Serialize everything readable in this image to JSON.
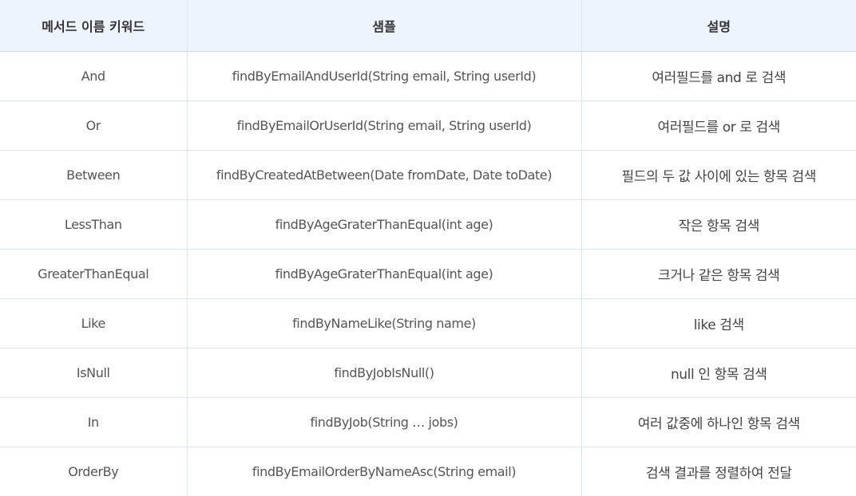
{
  "table": {
    "headers": [
      "메서드 이름 키워드",
      "샘플",
      "설명"
    ],
    "rows": [
      {
        "keyword": "And",
        "sample": "findByEmailAndUserId(String email, String userId)",
        "description": "여러필드를 and 로 검색"
      },
      {
        "keyword": "Or",
        "sample": "findByEmailOrUserId(String email, String userId)",
        "description": "여러필드를 or 로 검색"
      },
      {
        "keyword": "Between",
        "sample": "findByCreatedAtBetween(Date fromDate, Date toDate)",
        "description": "필드의 두 값 사이에 있는 항목 검색"
      },
      {
        "keyword": "LessThan",
        "sample": "findByAgeGraterThanEqual(int age)",
        "description": "작은 항목 검색"
      },
      {
        "keyword": "GreaterThanEqual",
        "sample": "findByAgeGraterThanEqual(int age)",
        "description": "크거나 같은 항목 검색"
      },
      {
        "keyword": "Like",
        "sample": "findByNameLike(String name)",
        "description": "like 검색"
      },
      {
        "keyword": "IsNull",
        "sample": "findByJobIsNull()",
        "description": "null 인 항목 검색"
      },
      {
        "keyword": "In",
        "sample": "findByJob(String … jobs)",
        "description": "여러 값중에 하나인 항목 검색"
      },
      {
        "keyword": "OrderBy",
        "sample": "findByEmailOrderByNameAsc(String email)",
        "description": "검색 결과를 정렬하여 전달"
      }
    ]
  }
}
